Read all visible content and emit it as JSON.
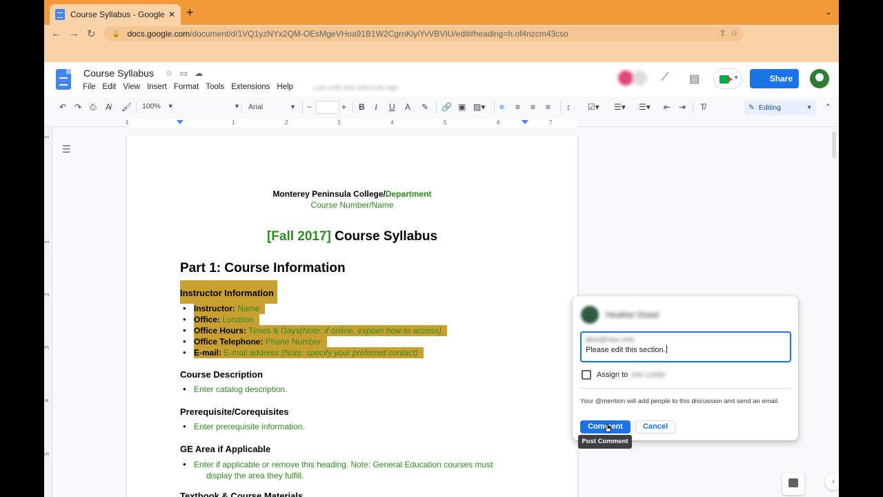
{
  "browser": {
    "tab_title": "Course Syllabus - Google Docs",
    "url_domain": "docs.google.com",
    "url_path": "/document/d/1VQ1yzNYx2QM-OEsMgeVHoa91B1W2CgrnKiyiYvVBVIU/edit#heading=h.of4nzcm43cso"
  },
  "doc": {
    "title": "Course Syllabus",
    "menu": [
      "File",
      "Edit",
      "View",
      "Insert",
      "Format",
      "Tools",
      "Extensions",
      "Help"
    ],
    "last_edit": "Last edit was seconds ago",
    "share_label": "Share"
  },
  "toolbar": {
    "zoom": "100%",
    "font": "Arial",
    "mode": "Editing"
  },
  "ruler": [
    "1",
    "1",
    "2",
    "3",
    "4",
    "5",
    "6",
    "7"
  ],
  "vruler": [
    "1",
    "1",
    "2",
    "3",
    "4",
    "5"
  ],
  "content": {
    "college": "Monterey Peninsula College/",
    "department": "Department",
    "course_number": "Course Number/Name",
    "term": "[Fall 2017]",
    "doc_heading": " Course Syllabus",
    "part1": "Part 1: Course Information",
    "instructor_heading": "Instructor Information",
    "instructor": {
      "label": "Instructor:",
      "value": " Name"
    },
    "office": {
      "label": "Office:",
      "value": " Location"
    },
    "office_hours": {
      "label": "Office Hours:",
      "value": " Times & Days",
      "note": "(Note: if online, explain how to access)"
    },
    "office_phone": {
      "label": "Office Telephone:",
      "value": " Phone Number"
    },
    "email": {
      "label": "E-mail:",
      "value": " E-mail address ",
      "note": "(Note: specify your preferred contact)"
    },
    "course_desc_h": "Course Description",
    "course_desc": "Enter catalog description.",
    "prereq_h": "Prerequisite/Corequisites",
    "prereq": "Enter prerequisite information.",
    "ge_h": "GE Area if Applicable",
    "ge_line1": "Enter if applicable or remove this heading. Note: General Education courses must",
    "ge_line2": "display the area they fulfill.",
    "textbook_h": "Textbook & Course Materials"
  },
  "comment": {
    "author": "Heather Dowd",
    "mention": "jdoe@mpc.edu",
    "text": "Please edit this section.",
    "assign_label": "Assign to",
    "assign_name": "Joe Lester",
    "note": "Your @mention will add people to this discussion and send an email.",
    "comment_button": "Comment",
    "cancel_button": "Cancel",
    "tooltip": "Post Comment"
  }
}
